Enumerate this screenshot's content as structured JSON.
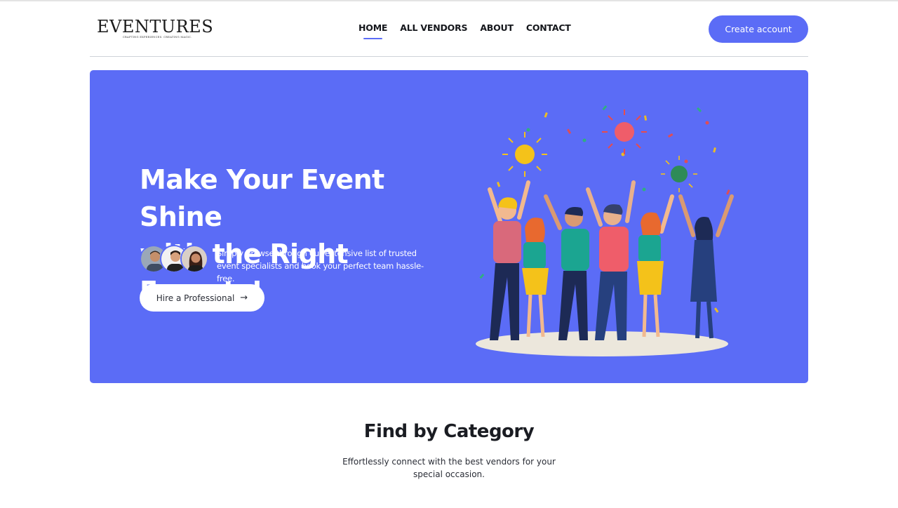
{
  "brand": {
    "name": "EVENTURES",
    "tagline": "CRAFTING EXPERIENCES. CREATING MAGIC."
  },
  "nav": {
    "items": [
      {
        "label": "HOME",
        "active": true
      },
      {
        "label": "ALL VENDORS",
        "active": false
      },
      {
        "label": "ABOUT",
        "active": false
      },
      {
        "label": "CONTACT",
        "active": false
      }
    ],
    "cta_label": "Create account"
  },
  "hero": {
    "title_line1": "Make Your Event Shine",
    "title_line2": "with the Right Experts!",
    "subtitle": "Simply browse through our extensive list of trusted event specialists and book your perfect team hassle-free.",
    "button_label": "Hire a Professional",
    "button_icon": "arrow-right-icon",
    "background_color": "#5b6cf6",
    "illustration": "celebrating-people-with-fireworks"
  },
  "category": {
    "title": "Find by Category",
    "subtitle": "Effortlessly connect with the best vendors for your special occasion."
  },
  "colors": {
    "accent": "#5b6cf6",
    "text": "#1f2430"
  }
}
